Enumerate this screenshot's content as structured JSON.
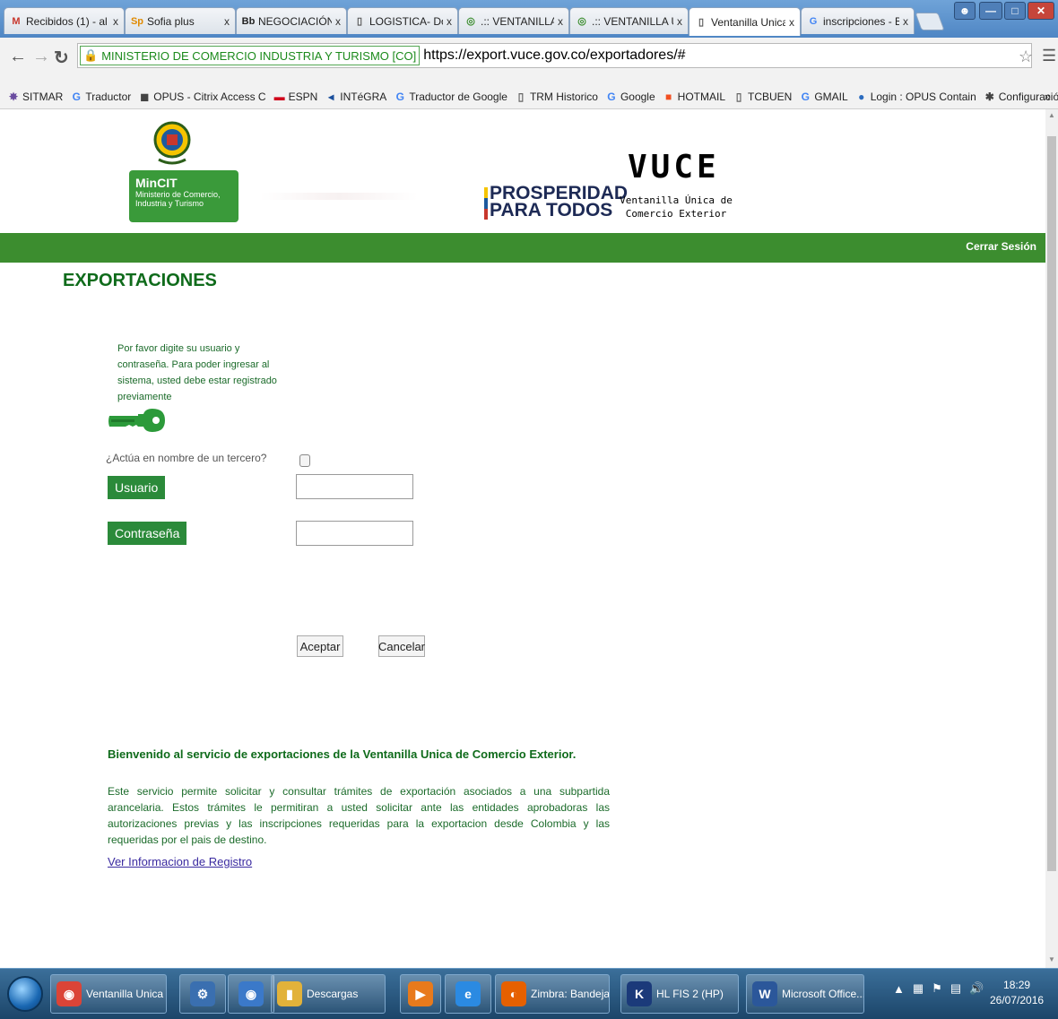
{
  "browser": {
    "tabs": [
      {
        "label": "Recibidos (1) - al",
        "favicon": "gmail-icon",
        "favicon_text": "M",
        "favicon_color": "#c8372d"
      },
      {
        "label": "Sofia plus",
        "favicon": "sofia-icon",
        "favicon_text": "Sp",
        "favicon_color": "#e08a00"
      },
      {
        "label": "NEGOCIACIÓN II",
        "favicon": "blackboard-icon",
        "favicon_text": "Bb",
        "favicon_color": "#222222"
      },
      {
        "label": "LOGISTICA- Docu",
        "favicon": "document-icon",
        "favicon_text": "▯",
        "favicon_color": "#555555"
      },
      {
        "label": ".:: VENTANILLA Ú",
        "favicon": "seal-icon",
        "favicon_text": "◎",
        "favicon_color": "#3c8d2f"
      },
      {
        "label": ".:: VENTANILLA Ú",
        "favicon": "seal-icon",
        "favicon_text": "◎",
        "favicon_color": "#3c8d2f"
      },
      {
        "label": "Ventanilla Unica",
        "favicon": "document-icon",
        "favicon_text": "▯",
        "favicon_color": "#555555",
        "active": true
      },
      {
        "label": "inscripciones - B",
        "favicon": "google-icon",
        "favicon_text": "G",
        "favicon_color": "#4285f4"
      }
    ],
    "tab_close": "x",
    "security_label": "MINISTERIO DE COMERCIO INDUSTRIA Y TURISMO [CO]",
    "url": "https://export.vuce.gov.co/exportadores/#",
    "bookmarks": [
      {
        "label": "SITMAR",
        "icon": "sitmar-icon",
        "glyph": "✸",
        "color": "#6a4ca0"
      },
      {
        "label": "Traductor",
        "icon": "google-icon",
        "glyph": "G",
        "color": "#4285f4"
      },
      {
        "label": "OPUS - Citrix Access C",
        "icon": "citrix-icon",
        "glyph": "◼",
        "color": "#444444"
      },
      {
        "label": "ESPN",
        "icon": "espn-icon",
        "glyph": "▬",
        "color": "#d0021b"
      },
      {
        "label": "INTéGRA",
        "icon": "integra-icon",
        "glyph": "◂",
        "color": "#1a4f9c"
      },
      {
        "label": "Traductor de Google",
        "icon": "google-translate-icon",
        "glyph": "G",
        "color": "#4285f4"
      },
      {
        "label": "TRM Historico",
        "icon": "document-icon",
        "glyph": "▯",
        "color": "#666666"
      },
      {
        "label": "Google",
        "icon": "google-icon",
        "glyph": "G",
        "color": "#4285f4"
      },
      {
        "label": "HOTMAIL",
        "icon": "windows-icon",
        "glyph": "■",
        "color": "#f25022"
      },
      {
        "label": "TCBUEN",
        "icon": "document-icon",
        "glyph": "▯",
        "color": "#666666"
      },
      {
        "label": "GMAIL",
        "icon": "google-icon",
        "glyph": "G",
        "color": "#4285f4"
      },
      {
        "label": "Login : OPUS Contain",
        "icon": "opus-icon",
        "glyph": "●",
        "color": "#2c6cbf"
      },
      {
        "label": "Configuración",
        "icon": "gear-icon",
        "glyph": "✱",
        "color": "#444444"
      }
    ],
    "bookmarks_more": "»"
  },
  "page": {
    "logo": {
      "mincit_title": "MinCIT",
      "mincit_sub_1": "Ministerio de Comercio,",
      "mincit_sub_2": "Industria y Turismo",
      "prosperidad_1": "PROSPERIDAD",
      "prosperidad_2": "PARA TODOS",
      "vuce_title": "VUCE",
      "vuce_sub_1": "Ventanilla Única de",
      "vuce_sub_2": "Comercio Exterior"
    },
    "logout_label": "Cerrar Sesión",
    "section_title": "EXPORTACIONES",
    "instructions": "Por favor digite su usuario y contraseña. Para poder ingresar al sistema, usted debe estar registrado previamente",
    "third_party_label": "¿Actúa en nombre de un tercero?",
    "third_party_checked": false,
    "user_label": "Usuario",
    "user_value": "",
    "password_label": "Contraseña",
    "password_value": "",
    "accept_label": "Aceptar",
    "cancel_label": "Cancelar",
    "welcome": "Bienvenido al servicio de exportaciones de la Ventanilla Unica de Comercio Exterior.",
    "description": "Este servicio permite solicitar y consultar trámites de exportación asociados a una subpartida arancelaria. Estos trámites le permitiran a usted solicitar ante las entidades aprobadoras las autorizaciones previas y las inscripciones requeridas para la exportacion desde Colombia y las requeridas por el pais de destino.",
    "register_link": "Ver Informacion de Registro"
  },
  "taskbar": {
    "items": [
      {
        "label": "Ventanilla Unica d...",
        "icon": "chrome-icon",
        "glyph": "◉",
        "color": "#db4437"
      },
      {
        "label": "",
        "icon": "network-icon",
        "glyph": "⚙",
        "color": "#3a6fb0"
      },
      {
        "label": "",
        "icon": "chrome-icon",
        "glyph": "◉",
        "color": "#3b79c9"
      },
      {
        "label": "Descargas",
        "icon": "folder-icon",
        "glyph": "▮",
        "color": "#e2b23a"
      },
      {
        "label": "",
        "icon": "media-player-icon",
        "glyph": "▶",
        "color": "#e87a1c"
      },
      {
        "label": "",
        "icon": "internet-explorer-icon",
        "glyph": "e",
        "color": "#2b8ae2"
      },
      {
        "label": "Zimbra: Bandeja ...",
        "icon": "firefox-icon",
        "glyph": "◐",
        "color": "#e66000"
      },
      {
        "label": "HL FIS 2 (HP)",
        "icon": "hapag-lloyd-icon",
        "glyph": "K",
        "color": "#1b3a7a"
      },
      {
        "label": "Microsoft Office...",
        "icon": "word-icon",
        "glyph": "W",
        "color": "#2b579a"
      }
    ],
    "clock_time": "18:29",
    "clock_date": "26/07/2016"
  }
}
